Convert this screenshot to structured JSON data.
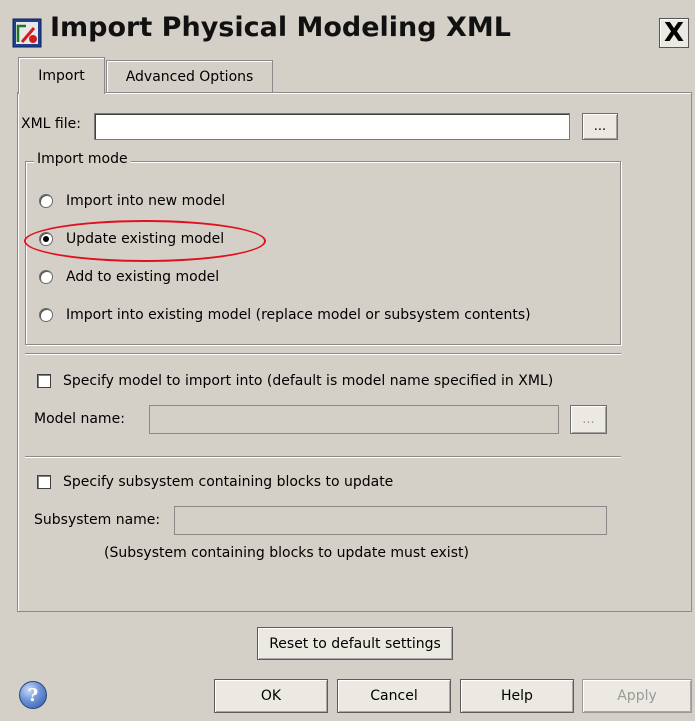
{
  "window": {
    "title": "Import Physical Modeling XML",
    "close_label": "X"
  },
  "tabs": [
    {
      "label": "Import",
      "active": true
    },
    {
      "label": "Advanced Options",
      "active": false
    }
  ],
  "xml_file": {
    "label": "XML file:",
    "value": "",
    "browse_label": "..."
  },
  "import_mode": {
    "title": "Import mode",
    "options": [
      {
        "label": "Import into new model",
        "selected": false
      },
      {
        "label": "Update existing model",
        "selected": true
      },
      {
        "label": "Add to existing model",
        "selected": false
      },
      {
        "label": "Import into existing model (replace model or subsystem contents)",
        "selected": false
      }
    ]
  },
  "model": {
    "checkbox_label": "Specify model to import into (default is model name specified in XML)",
    "checked": false,
    "name_label": "Model name:",
    "name_value": "",
    "browse_label": "..."
  },
  "subsystem": {
    "checkbox_label": "Specify subsystem containing blocks to update",
    "checked": false,
    "name_label": "Subsystem name:",
    "name_value": "",
    "note": "(Subsystem containing blocks to update must exist)"
  },
  "buttons": {
    "reset": "Reset to default settings",
    "ok": "OK",
    "cancel": "Cancel",
    "help": "Help",
    "apply": "Apply"
  },
  "icons": {
    "app": "simulink-app-icon",
    "help": "help-question-icon"
  },
  "colors": {
    "highlight": "#e0101e",
    "dialog_bg": "#d4d0c8"
  }
}
